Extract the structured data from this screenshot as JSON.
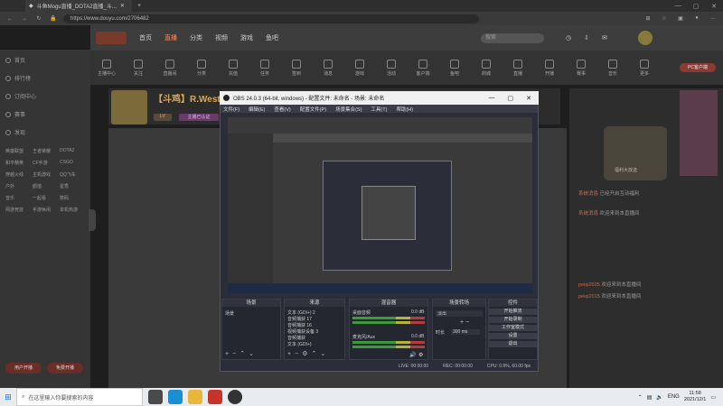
{
  "browser": {
    "tab_title": "斗鱼Mogu直播_DOTA2直播_斗...",
    "url": "https://www.douyu.com/2706482"
  },
  "douyu": {
    "nav": [
      "首页",
      "直播",
      "分类",
      "视频",
      "游戏",
      "鱼吧"
    ],
    "active_nav_index": 1,
    "search_placeholder": "搜索",
    "categories": [
      "主播中心",
      "关注",
      "直播间",
      "分类",
      "充值",
      "任务",
      "签到",
      "消息",
      "游戏",
      "活动",
      "客户端",
      "鱼吧",
      "商城",
      "直播",
      "开播",
      "赛事",
      "音乐",
      "更多"
    ],
    "pc_client_label": "PC客户端",
    "sidebar": {
      "items": [
        "首页",
        "排行榜",
        "订阅中心",
        "赛事",
        "发现"
      ],
      "grid": [
        "英雄联盟",
        "王者荣耀",
        "DOTA2",
        "和平精英",
        "CF手游",
        "CSGO",
        "穿越火线",
        "主机游戏",
        "QQ飞车",
        "户外",
        "颜值",
        "星秀",
        "音乐",
        "一起看",
        "数码",
        "网游竞技",
        "手游休闲",
        "单机热游"
      ],
      "btn_left": "用户开播",
      "btn_right": "免费开播"
    },
    "room": {
      "title": "【斗鸡】R.Westbrook",
      "tag1": "LV",
      "tag2": "主播已认证"
    },
    "chat_lines": [
      {
        "name": "系统消息",
        "text": "已经开启互动福利"
      },
      {
        "name": "系统消息",
        "text": "欢迎来到本直播间"
      },
      {
        "name": "peiqi2025",
        "text": "欢迎来到本直播间"
      },
      {
        "name": "peiqi2015",
        "text": "欢迎来到本直播间"
      }
    ],
    "promo_label": "福利大放送"
  },
  "obs": {
    "title": "OBS 24.0.3 (64-bit, windows) - 配置文件: 未命名 - 场景: 未命名",
    "menu": [
      "文件(F)",
      "编辑(E)",
      "查看(V)",
      "配置文件(P)",
      "场景集合(S)",
      "工具(T)",
      "帮助(H)"
    ],
    "docks": {
      "scenes": {
        "title": "场景",
        "items": [
          "场景"
        ]
      },
      "sources": {
        "title": "来源",
        "items": [
          "文本 (GDI+) 2",
          "音频捕获 17",
          "音频捕获 16",
          "视频捕获设备 3",
          "音频捕获",
          "文本 (GDI+)"
        ]
      },
      "mixer": {
        "title": "混音器",
        "tracks": [
          {
            "name": "桌面音频",
            "db": "0.0 dB"
          },
          {
            "name": "麦克风/Aux",
            "db": "0.0 dB"
          }
        ]
      },
      "transitions": {
        "title": "场景转场",
        "type": "淡出",
        "duration_label": "时长",
        "duration": "300 ms"
      },
      "controls": {
        "title": "控件",
        "buttons": [
          "开始推流",
          "开始录制",
          "工作室模式",
          "设置",
          "退出"
        ]
      }
    },
    "status": {
      "live": "LIVE: 00:00:00",
      "rec": "REC: 00:00:00",
      "cpu": "CPU: 0.9%, 60.00 fps"
    }
  },
  "taskbar": {
    "search_placeholder": "在这里输入你要搜索的内容",
    "lang": "ENG",
    "time": "11:58",
    "date": "2021/12/1"
  }
}
